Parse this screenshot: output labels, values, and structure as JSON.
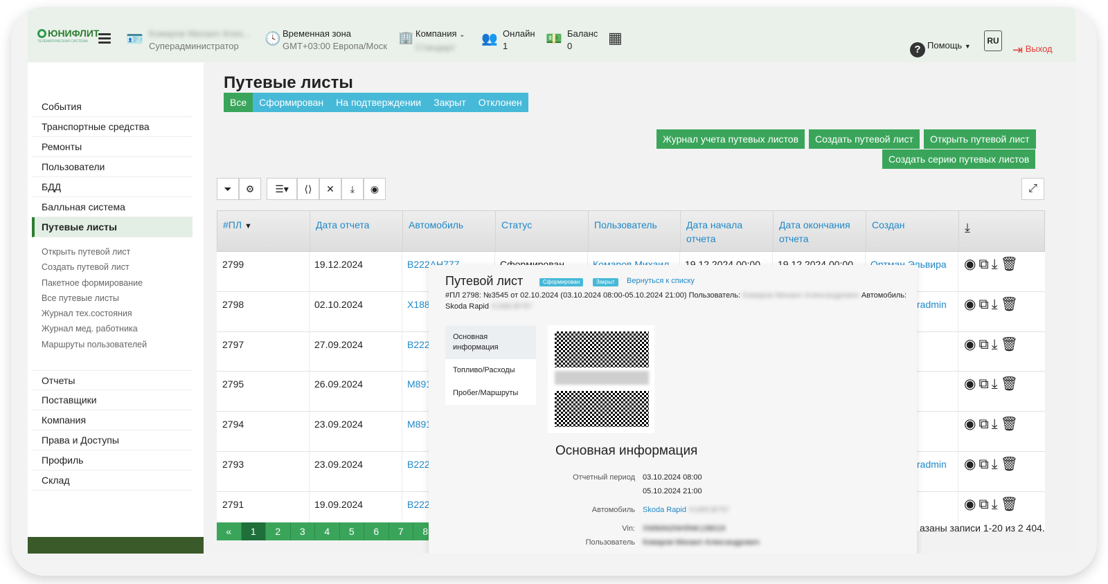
{
  "header": {
    "logo_text": "ЮНИФЛИТ",
    "logo_tagline": "ТЕЛЕМАТИЧЕСКАЯ СИСТЕМА",
    "user_name": "Комаров Михаил Алек...",
    "user_role": "Суперадминистратор",
    "timezone_label": "Временная зона",
    "timezone_value": "GMT+03:00 Европа/Моск",
    "company_label": "Компания",
    "company_value": "Стандарт",
    "online_label": "Онлайн",
    "online_value": "1",
    "balance_label": "Баланс",
    "balance_value": "0",
    "help_label": "Помощь",
    "lang_label": "RU",
    "logout_label": "Выход"
  },
  "sidebar": {
    "main_items": [
      {
        "label": "События"
      },
      {
        "label": "Транспортные средства"
      },
      {
        "label": "Ремонты"
      },
      {
        "label": "Пользователи"
      },
      {
        "label": "БДД"
      },
      {
        "label": "Балльная система"
      },
      {
        "label": "Путевые листы"
      }
    ],
    "sub_items": [
      {
        "label": "Открыть путевой лист"
      },
      {
        "label": "Создать путевой лист"
      },
      {
        "label": "Пакетное формирование"
      },
      {
        "label": "Все путевые листы"
      },
      {
        "label": "Журнал тех.состояния"
      },
      {
        "label": "Журнал мед. работника"
      },
      {
        "label": "Маршруты пользователей"
      }
    ],
    "main_items2": [
      {
        "label": "Отчеты"
      },
      {
        "label": "Поставщики"
      },
      {
        "label": "Компания"
      },
      {
        "label": "Права и Доступы"
      },
      {
        "label": "Профиль"
      },
      {
        "label": "Склад"
      }
    ]
  },
  "page": {
    "title": "Путевые листы",
    "tabs": [
      {
        "label": "Все"
      },
      {
        "label": "Сформирован"
      },
      {
        "label": "На подтверждении"
      },
      {
        "label": "Закрыт"
      },
      {
        "label": "Отклонен"
      }
    ],
    "buttons": {
      "journal": "Журнал учета путевых листов",
      "create": "Создать путевой лист",
      "open": "Открыть путевой лист",
      "create_series": "Создать серию путевых листов"
    }
  },
  "table": {
    "headers": {
      "id": "#ПЛ",
      "report_date": "Дата отчета",
      "vehicle": "Автомобиль",
      "status": "Статус",
      "user": "Пользователь",
      "start_line1": "Дата начала",
      "start_line2": "отчета",
      "end_line1": "Дата окончания",
      "end_line2": "отчета",
      "created": "Создан"
    },
    "rows": [
      {
        "id": "2799",
        "date": "19.12.2024",
        "vehicle": "В222АН777",
        "status": "Сформирован",
        "user": "Комаров Михаил",
        "start": "19.12.2024 00:00",
        "end": "19.12.2024 00:00",
        "created": "Ортман Эльвира"
      },
      {
        "id": "2798",
        "date": "02.10.2024",
        "vehicle": "Х188",
        "created": "radmin"
      },
      {
        "id": "2797",
        "date": "27.09.2024",
        "vehicle": "В222"
      },
      {
        "id": "2795",
        "date": "26.09.2024",
        "vehicle": "М891"
      },
      {
        "id": "2794",
        "date": "23.09.2024",
        "vehicle": "М891"
      },
      {
        "id": "2793",
        "date": "23.09.2024",
        "vehicle": "В222",
        "created": "radmin"
      },
      {
        "id": "2791",
        "date": "19.09.2024",
        "vehicle": "В222"
      }
    ]
  },
  "pagination": {
    "pages": [
      "«",
      "1",
      "2",
      "3",
      "4",
      "5",
      "6",
      "7",
      "8"
    ],
    "records_text": "азаны записи 1-20 из 2 404."
  },
  "popup": {
    "title": "Путевой лист",
    "badge_status": "Сформирован",
    "badge_closed": "Закрыт",
    "back_link": "Вернуться к списку",
    "desc_main": "#ПЛ 2798: №3545 от 02.10.2024 (03.10.2024 08:00-05.10.2024 21:00) Пользователь:",
    "desc_user": "Комаров Михаил Александрович",
    "desc_vehicle_label": "Автомобиль:",
    "desc_vehicle": "Skoda Rapid",
    "desc_plate": "Х188СВ797",
    "tabs": [
      {
        "label": "Основная информация"
      },
      {
        "label": "Топливо/Расходы"
      },
      {
        "label": "Пробег/Маршруты"
      }
    ],
    "section_title": "Основная информация",
    "fields": {
      "period_label": "Отчетный период",
      "period_start": "03.10.2024 08:00",
      "period_end": "05.10.2024 21:00",
      "vehicle_label": "Автомобиль",
      "vehicle_value": "Skoda Rapid",
      "vehicle_plate": "Х188СВ797",
      "vin_label": "Vin:",
      "vin_value": "XW8AN2NH5NK138019",
      "user_label": "Пользователь",
      "user_value": "Комаров Михаил Александрович"
    }
  },
  "colors": {
    "accent_green": "#3aa55a",
    "accent_blue": "#47b9d8",
    "link_blue": "#1e88c8",
    "logout_red": "#e53935"
  }
}
